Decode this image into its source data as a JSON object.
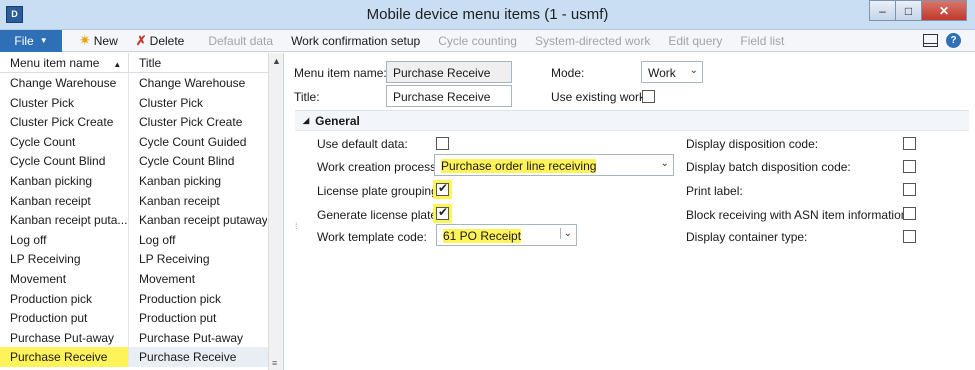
{
  "window": {
    "title": "Mobile device menu items (1 - usmf)",
    "app_icon_text": "D",
    "buttons": {
      "minimize": "–",
      "maximize": "□",
      "close": "✕"
    }
  },
  "toolbar": {
    "file": "File",
    "new": "New",
    "delete": "Delete",
    "default_data": "Default data",
    "work_confirmation_setup": "Work confirmation setup",
    "cycle_counting": "Cycle counting",
    "system_directed_work": "System-directed work",
    "edit_query": "Edit query",
    "field_list": "Field list",
    "help": "?"
  },
  "grid": {
    "columns": [
      "Menu item name",
      "Title"
    ],
    "rows": [
      [
        "Change Warehouse",
        "Change Warehouse"
      ],
      [
        "Cluster Pick",
        "Cluster Pick"
      ],
      [
        "Cluster Pick Create",
        "Cluster Pick Create"
      ],
      [
        "Cycle Count",
        "Cycle Count Guided"
      ],
      [
        "Cycle Count Blind",
        "Cycle Count Blind"
      ],
      [
        "Kanban picking",
        "Kanban picking"
      ],
      [
        "Kanban receipt",
        "Kanban receipt"
      ],
      [
        "Kanban receipt puta...",
        "Kanban receipt putaway"
      ],
      [
        "Log off",
        "Log off"
      ],
      [
        "LP Receiving",
        "LP Receiving"
      ],
      [
        "Movement",
        "Movement"
      ],
      [
        "Production pick",
        "Production pick"
      ],
      [
        "Production put",
        "Production put"
      ],
      [
        "Purchase Put-away",
        "Purchase Put-away"
      ],
      [
        "Purchase Receive",
        "Purchase Receive"
      ]
    ],
    "selected_index": 14
  },
  "header_fields": {
    "menu_item_name_label": "Menu item name:",
    "menu_item_name_value": "Purchase Receive",
    "title_label": "Title:",
    "title_value": "Purchase Receive",
    "mode_label": "Mode:",
    "mode_value": "Work",
    "use_existing_work_label": "Use existing work:",
    "use_existing_work_checked": false
  },
  "general": {
    "tab_label": "General",
    "left": {
      "use_default_data_label": "Use default data:",
      "use_default_data_checked": false,
      "work_creation_process_label": "Work creation process:",
      "work_creation_process_value": "Purchase order line receiving",
      "license_plate_grouping_label": "License plate grouping:",
      "license_plate_grouping_checked": true,
      "generate_license_plate_label": "Generate license plate:",
      "generate_license_plate_checked": true,
      "work_template_code_label": "Work template code:",
      "work_template_code_value": "61 PO Receipt"
    },
    "right": {
      "display_disposition_code_label": "Display disposition code:",
      "display_batch_disposition_code_label": "Display batch disposition code:",
      "print_label_label": "Print label:",
      "block_receiving_label": "Block receiving with ASN item information:",
      "display_container_type_label": "Display container type:"
    }
  },
  "colors": {
    "highlight": "#fff35a",
    "file_button": "#2f6fb5",
    "titlebar": "#c9def3"
  }
}
